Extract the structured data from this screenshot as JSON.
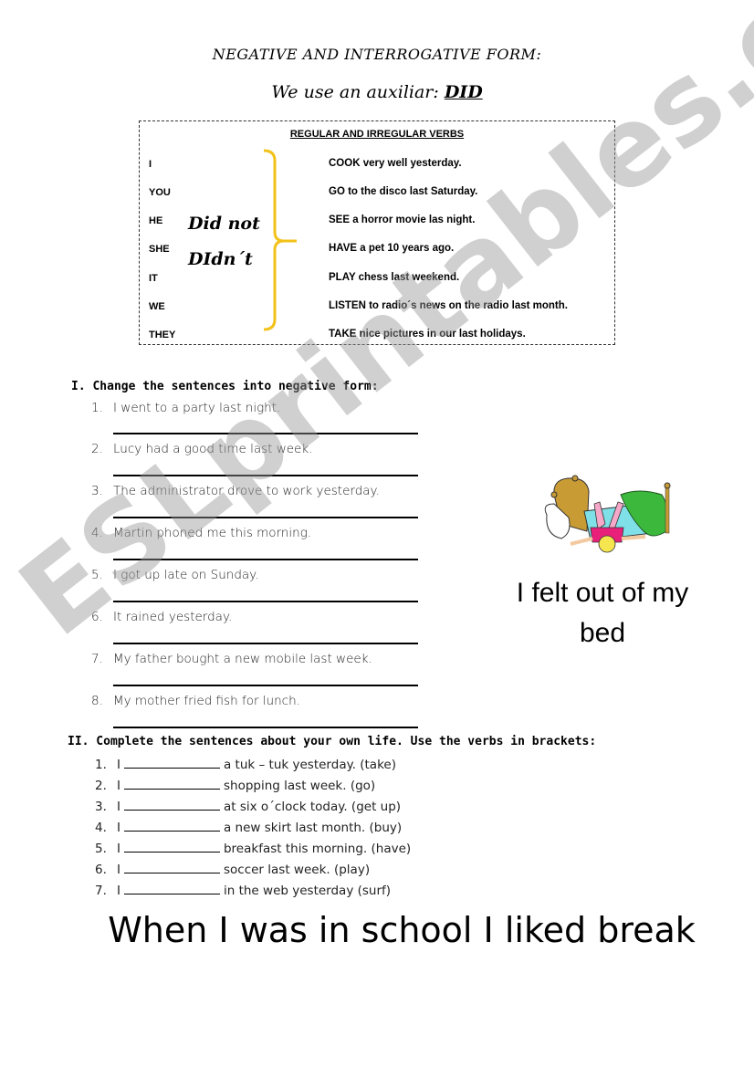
{
  "header": {
    "title": "NEGATIVE AND INTERROGATIVE FORM:",
    "subtitle_prefix": "We use an auxiliar: ",
    "subtitle_emphasis": "DID"
  },
  "verb_box": {
    "title": "REGULAR AND IRREGULAR VERBS",
    "pronouns": [
      "I",
      "YOU",
      "HE",
      "SHE",
      "IT",
      "WE",
      "THEY"
    ],
    "negatives": [
      "Did not",
      "DIdn´t"
    ],
    "sentences": [
      "COOK very well yesterday.",
      "GO to the disco last Saturday.",
      "SEE a horror movie las night.",
      "HAVE a pet 10 years ago.",
      "PLAY chess last weekend.",
      "LISTEN to radio´s news on the radio last month.",
      "TAKE  nice pictures in our last holidays."
    ],
    "brace_color": "#f2c21a"
  },
  "exercise1": {
    "heading": "I. Change the sentences into negative form:",
    "items": [
      {
        "num": "1.",
        "text": "I went to a party last night."
      },
      {
        "num": "2.",
        "text": "Lucy had a good time last week."
      },
      {
        "num": "3.",
        "text": "The administrator drove to work yesterday."
      },
      {
        "num": "4.",
        "text": "Martin phoned me this morning."
      },
      {
        "num": "5.",
        "text": "I got up late on Sunday."
      },
      {
        "num": "6.",
        "text": "It rained yesterday."
      },
      {
        "num": "7.",
        "text": "My father bought a new mobile last week."
      },
      {
        "num": "8.",
        "text": "My mother fried fish for lunch."
      }
    ]
  },
  "exercise2": {
    "heading": "II. Complete the sentences about your own life.  Use the verbs in brackets:",
    "items": [
      {
        "num": "1.",
        "subject": "I",
        "rest": "a tuk – tuk yesterday. (take)"
      },
      {
        "num": "2.",
        "subject": "I",
        "rest": "shopping last week. (go)"
      },
      {
        "num": "3.",
        "subject": "I",
        "rest": "at six o´clock today. (get up)"
      },
      {
        "num": "4.",
        "subject": "I",
        "rest": "a new skirt last month. (buy)"
      },
      {
        "num": "5.",
        "subject": "I",
        "rest": "breakfast this morning. (have)"
      },
      {
        "num": "6.",
        "subject": "I",
        "rest": "soccer last week. (play)"
      },
      {
        "num": "7.",
        "subject": "I",
        "rest": "in the web yesterday (surf)"
      }
    ]
  },
  "illustration": {
    "icon": "girl-falling-out-of-bed-illustration",
    "caption": "I felt out of my bed"
  },
  "closing": "When I was in school I liked break",
  "watermark": "ESLprintables.com"
}
